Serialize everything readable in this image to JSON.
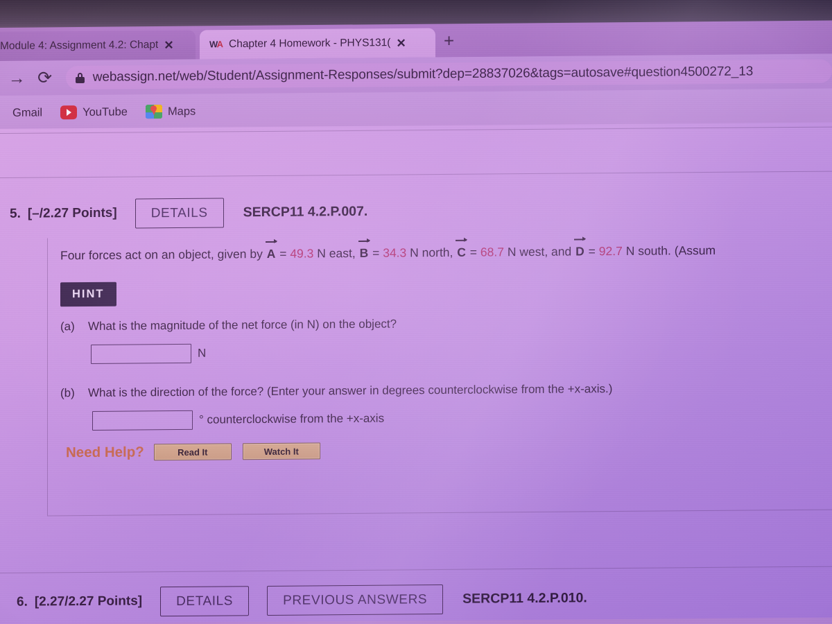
{
  "browser": {
    "tabs": [
      {
        "title": "Module 4: Assignment 4.2: Chapt",
        "close": "✕",
        "favicon": "generic-page-icon",
        "active": false
      },
      {
        "title": "Chapter 4 Homework - PHYS131(",
        "close": "✕",
        "favicon": "webassign-wa-icon",
        "active": true
      }
    ],
    "new_tab_label": "+",
    "back_icon": "→",
    "reload_icon": "⟳",
    "url": "webassign.net/web/Student/Assignment-Responses/submit?dep=28837026&tags=autosave#question4500272_13",
    "bookmarks": [
      {
        "label": "Gmail",
        "icon": "gmail-icon"
      },
      {
        "label": "YouTube",
        "icon": "youtube-icon"
      },
      {
        "label": "Maps",
        "icon": "google-maps-icon"
      }
    ]
  },
  "question5": {
    "number": "5.",
    "points": "[–/2.27 Points]",
    "details_label": "DETAILS",
    "code": "SERCP11 4.2.P.007.",
    "statement": {
      "lead": "Four forces act on an object, given by",
      "a_vec": "A",
      "a_eq": "=",
      "a_val": "49.3",
      "a_unit_dir": "N east,",
      "b_vec": "B",
      "b_eq": "=",
      "b_val": "34.3",
      "b_unit_dir": "N north,",
      "c_vec": "C",
      "c_eq": "=",
      "c_val": "68.7",
      "c_unit_dir": "N west, and",
      "d_vec": "D",
      "d_eq": "=",
      "d_val": "92.7",
      "d_unit_dir": "N south.",
      "tail": "(Assum"
    },
    "hint_label": "HINT",
    "parts": [
      {
        "label": "(a)",
        "prompt": "What is the magnitude of the net force (in N) on the object?",
        "answer_value": "",
        "unit": "N"
      },
      {
        "label": "(b)",
        "prompt": "What is the direction of the force? (Enter your answer in degrees counterclockwise from the +x-axis.)",
        "answer_value": "",
        "unit": "° counterclockwise from the +x-axis"
      }
    ],
    "need_help": {
      "label": "Need Help?",
      "read_it": "Read It",
      "watch_it": "Watch It"
    }
  },
  "question6": {
    "number": "6.",
    "points": "[2.27/2.27 Points]",
    "details_label": "DETAILS",
    "previous_answers_label": "PREVIOUS ANSWERS",
    "code": "SERCP11 4.2.P.010."
  },
  "colors": {
    "accent_number": "#b0255e",
    "need_help": "#c9663f",
    "hint_bg": "#2a1a3e",
    "page_bg": "#cf9ee6"
  }
}
